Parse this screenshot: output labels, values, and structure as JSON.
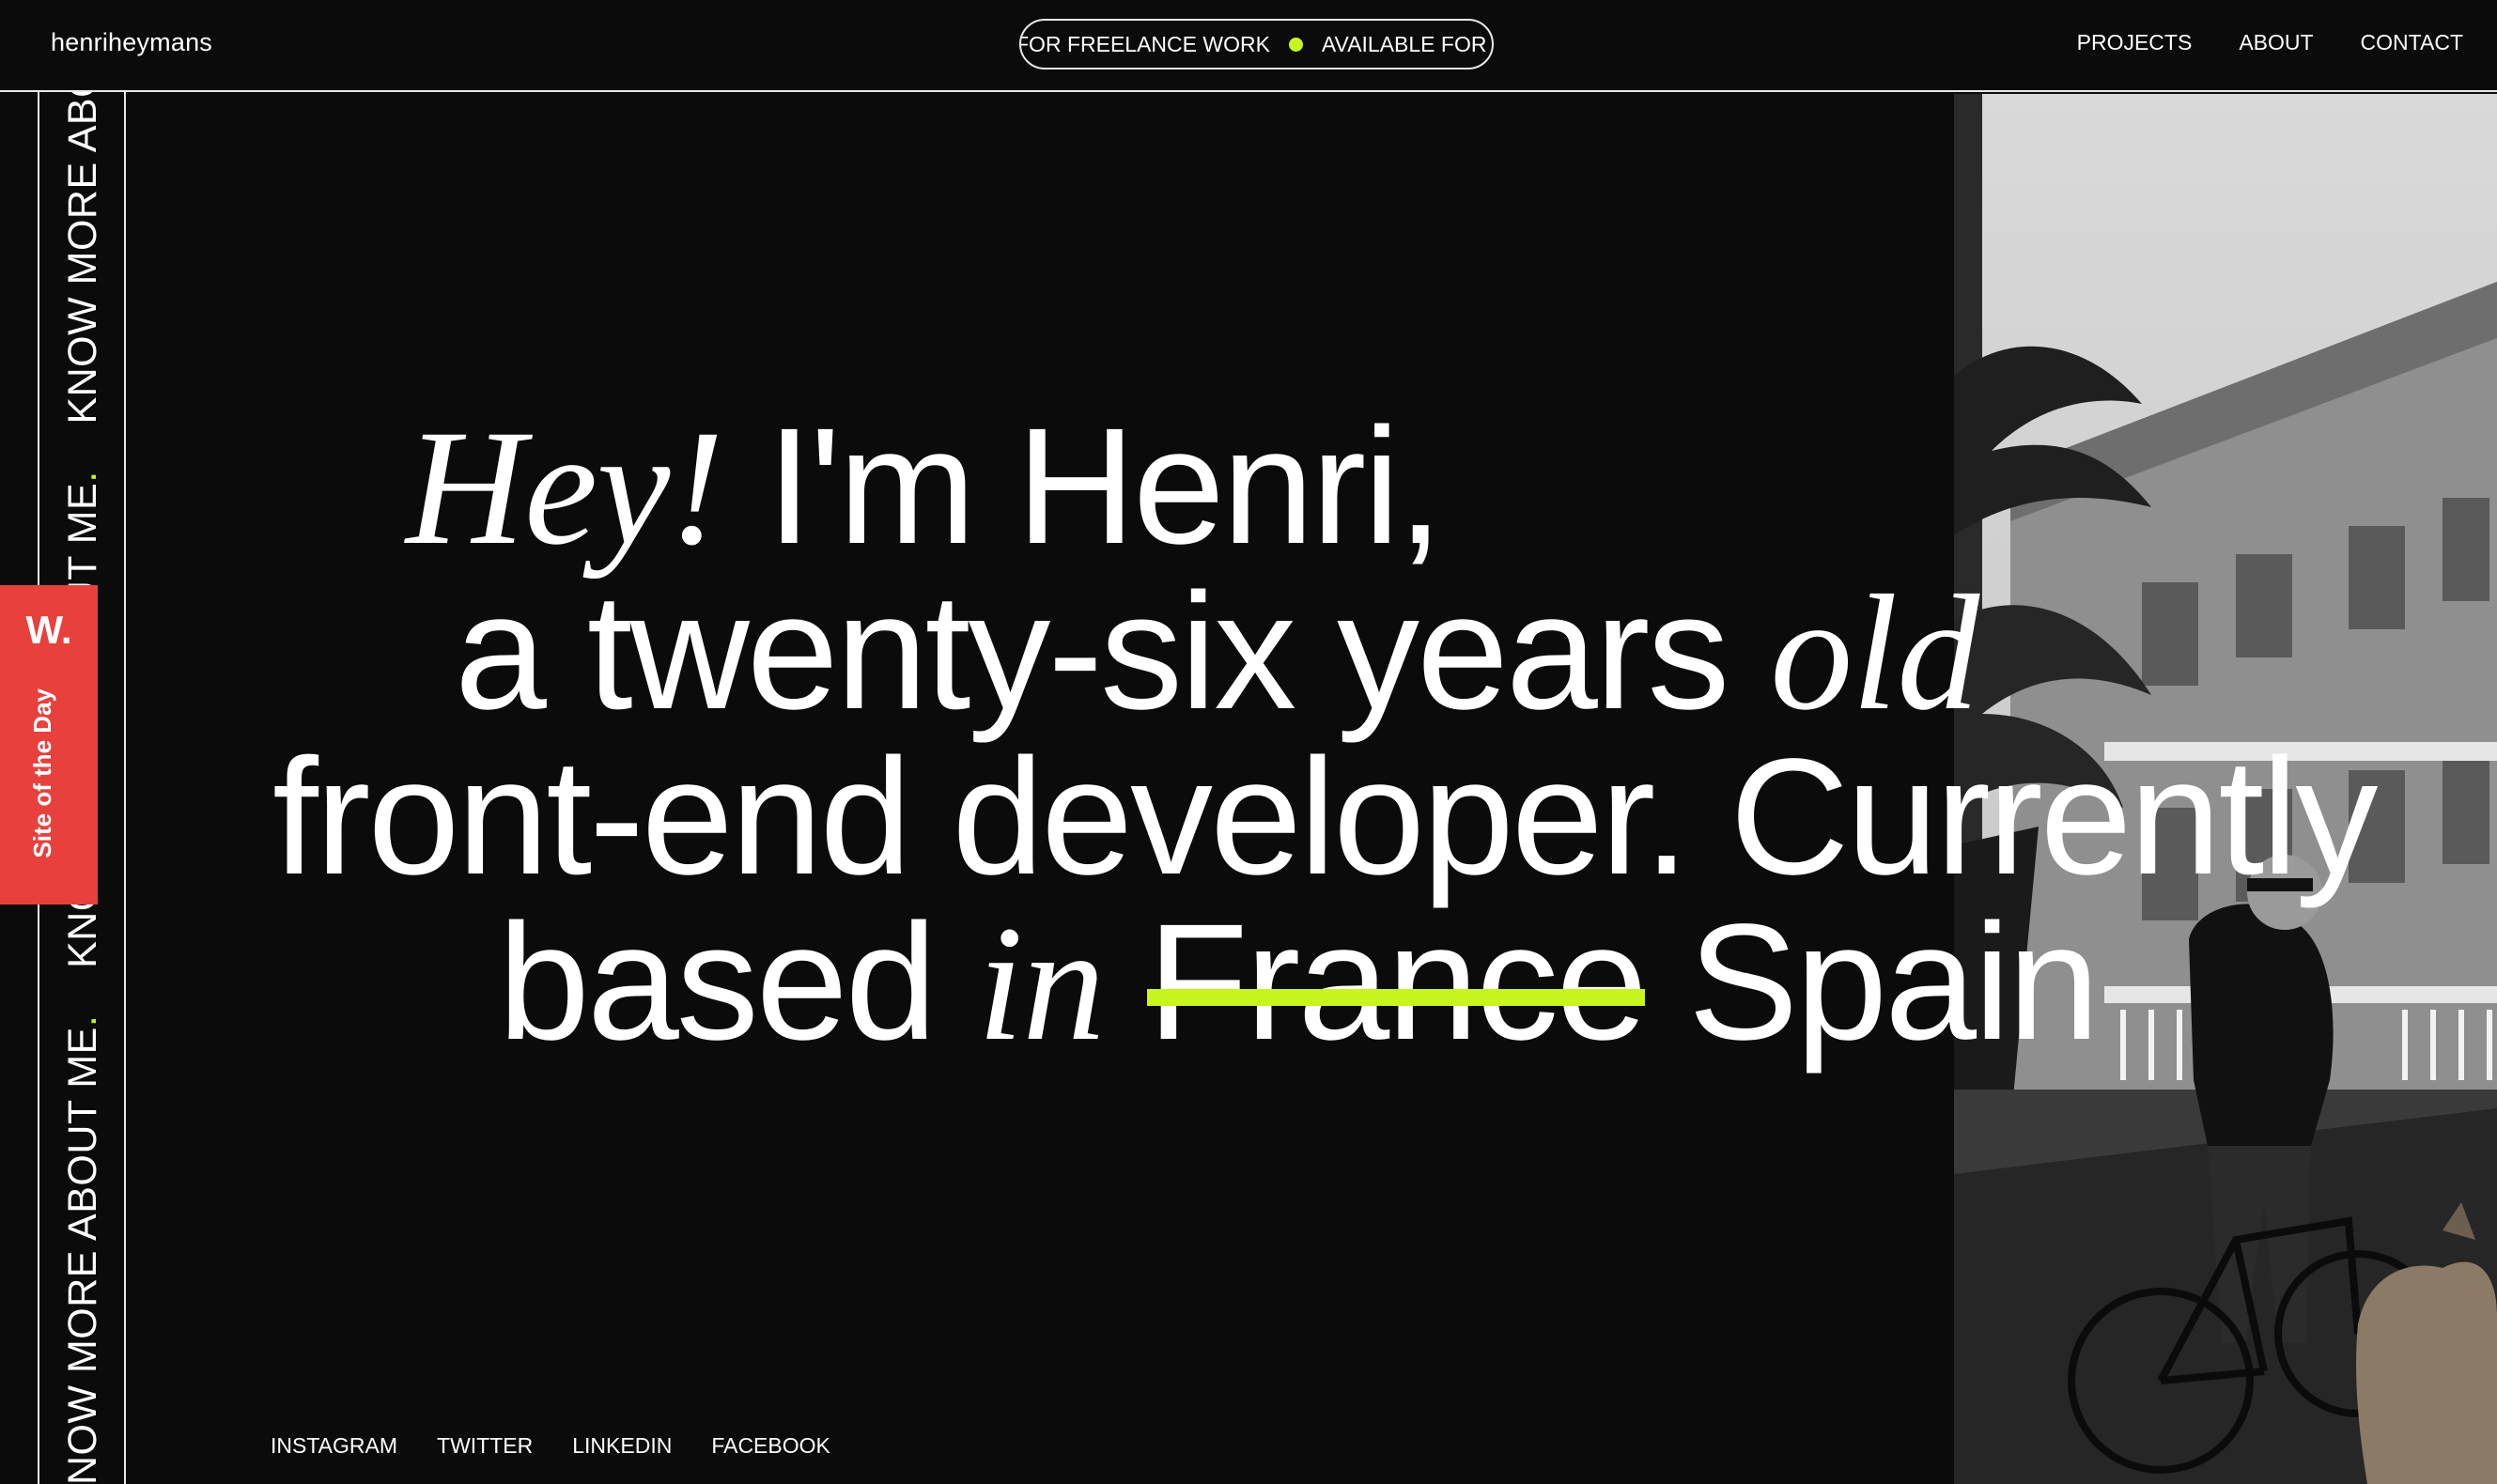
{
  "header": {
    "logo": "henriheymans",
    "availability": {
      "text_a": "FOR FREELANCE WORK",
      "text_b": "AVAILABLE FOR FREI",
      "dot_color": "#c6f51f"
    },
    "nav": [
      {
        "label": "PROJECTS"
      },
      {
        "label": "ABOUT"
      },
      {
        "label": "CONTACT"
      }
    ]
  },
  "side_marquee": {
    "text": "KNOW MORE ABOUT ME",
    "dot": "."
  },
  "award": {
    "logo": "W.",
    "label": "Site of the Day",
    "color": "#e8403d"
  },
  "hero": {
    "line1": {
      "italic": "Hey!",
      "plain": " I'm Henri,"
    },
    "line2": {
      "plain": "a twenty-six years ",
      "italic": "old"
    },
    "line3": {
      "plain": "front-end developer. Currently"
    },
    "line4": {
      "plain_a": "based ",
      "italic": "in",
      "struck": "France",
      "plain_b": " Spain"
    },
    "accent_color": "#c6f51f"
  },
  "photo": {
    "alt": "portrait-with-bicycle-and-dog"
  },
  "social": [
    {
      "label": "INSTAGRAM"
    },
    {
      "label": "TWITTER"
    },
    {
      "label": "LINKEDIN"
    },
    {
      "label": "FACEBOOK"
    }
  ]
}
